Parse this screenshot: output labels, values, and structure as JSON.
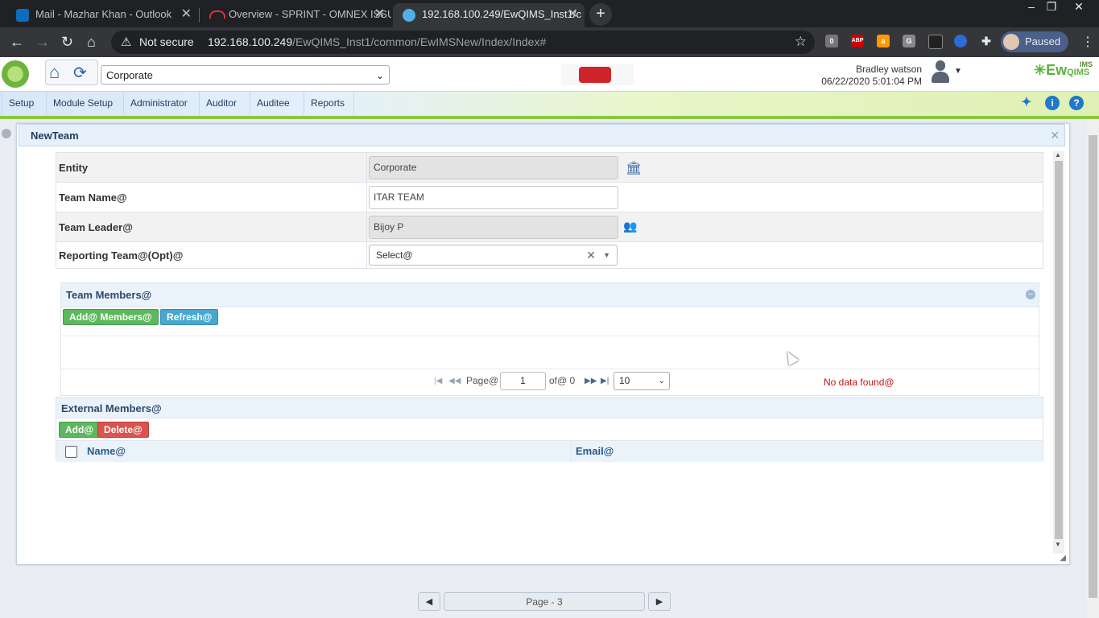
{
  "browser": {
    "tabs": [
      {
        "title": "Mail - Mazhar Khan - Outlook",
        "favicon": "outlook-icon",
        "active": false
      },
      {
        "title": "Overview - SPRINT - OMNEX ISSU",
        "favicon": "jira-icon",
        "active": false
      },
      {
        "title": "192.168.100.249/EwQIMS_Inst1/c",
        "favicon": "globe-icon",
        "active": true
      }
    ],
    "new_tab": "+",
    "security_label": "Not secure",
    "url_host": "192.168.100.249",
    "url_path": "/EwQIMS_Inst1/common/EwIMSNew/Index/Index#",
    "profile_label": "Paused",
    "extensions": {
      "e1": "0",
      "abp": "ABP",
      "e3": "a",
      "e4": "G"
    }
  },
  "app": {
    "entity_selected": "Corporate",
    "user_name": "Bradley watson",
    "datetime": "06/22/2020 5:01:04 PM",
    "logo_text": "Ew",
    "logo_suffix": "QIMS",
    "logo_sup": "IMS",
    "menu": [
      "Setup",
      "Module Setup",
      "Administrator",
      "Auditor",
      "Auditee",
      "Reports"
    ]
  },
  "dialog": {
    "title": "NewTeam",
    "fields": {
      "entity_label": "Entity",
      "entity_value": "Corporate",
      "team_name_label": "Team Name@",
      "team_name_value": "ITAR TEAM",
      "team_leader_label": "Team Leader@",
      "team_leader_value": "Bijoy P",
      "reporting_team_label": "Reporting Team@(Opt)@",
      "reporting_team_value": "Select@"
    },
    "team_members": {
      "title": "Team Members@",
      "add_button": "Add@ Members@",
      "refresh_button": "Refresh@",
      "pager": {
        "page_label": "Page@",
        "page_value": "1",
        "of_label": "of@ 0",
        "page_size": "10",
        "no_data": "No data found@"
      }
    },
    "external_members": {
      "title": "External Members@",
      "add_button": "Add@",
      "delete_button": "Delete@",
      "columns": [
        "Name@",
        "Email@"
      ]
    }
  },
  "footer": {
    "page_indicator": "Page - 3"
  },
  "colors": {
    "accent_green": "#8cc63f",
    "button_green": "#5cb85c",
    "button_blue": "#46a8d0",
    "button_red": "#d9534f",
    "error_red": "#cc1111"
  }
}
